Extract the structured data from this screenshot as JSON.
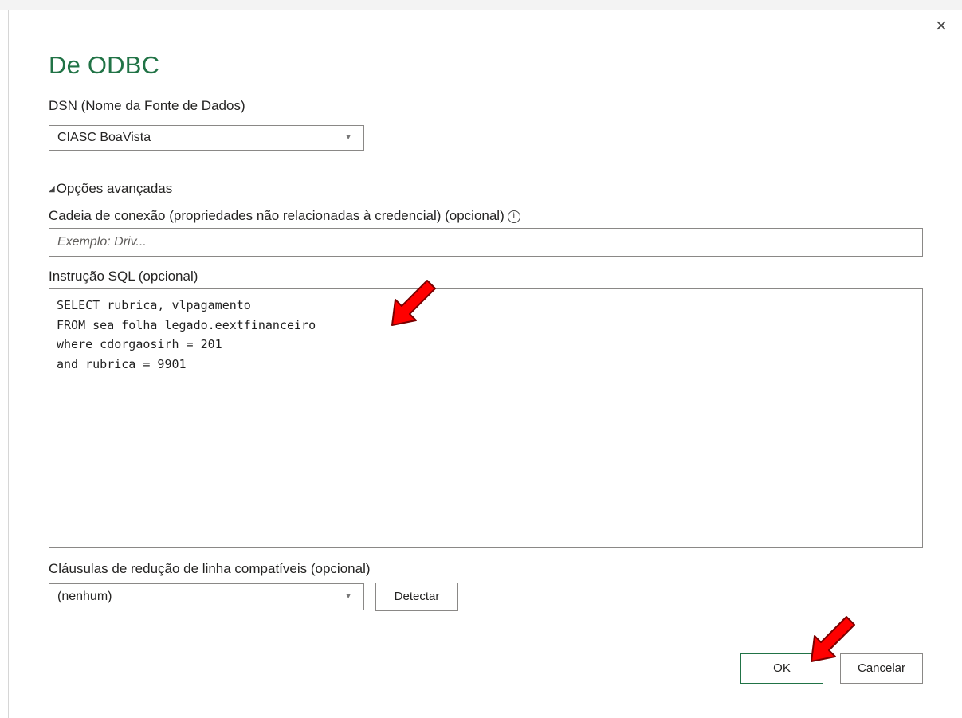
{
  "dialog": {
    "title": "De ODBC",
    "close_icon": "×"
  },
  "dsn": {
    "label": "DSN (Nome da Fonte de Dados)",
    "selected": "CIASC BoaVista"
  },
  "advanced": {
    "toggle_label": "Opções avançadas",
    "toggle_icon": "◢",
    "connection_string_label": "Cadeia de conexão (propriedades não relacionadas à credencial) (opcional)",
    "connection_string_placeholder": "Exemplo: Driv...",
    "connection_string_value": "",
    "info_icon": "i",
    "sql_label": "Instrução SQL (opcional)",
    "sql_value": "SELECT rubrica, vlpagamento\nFROM sea_folha_legado.eextfinanceiro\nwhere cdorgaosirh = 201\nand rubrica = 9901",
    "row_reduction_label": "Cláusulas de redução de linha compatíveis (opcional)",
    "row_reduction_selected": "(nenhum)",
    "detect_button": "Detectar"
  },
  "footer": {
    "ok_button": "OK",
    "cancel_button": "Cancelar"
  },
  "colors": {
    "accent": "#217346",
    "annotation_arrow": "#ff0000"
  },
  "annotations": {
    "arrow_icon": "red-arrow-icon"
  }
}
